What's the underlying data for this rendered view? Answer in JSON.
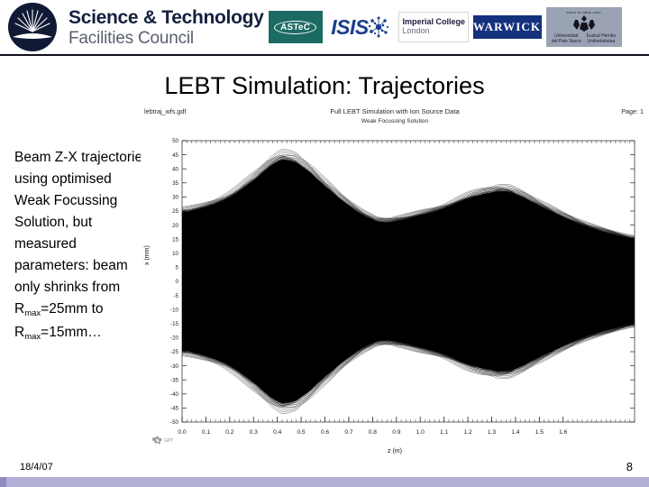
{
  "header": {
    "organisation": {
      "line1": "Science & Technology",
      "line2": "Facilities Council",
      "logo_icon": "stfc-sunburst-icon",
      "brand_color": "#111a35"
    },
    "partner_logos": [
      {
        "name": "astec-logo",
        "label": "ASTeC",
        "background": "#1c6b63",
        "text_color": "#ffffff"
      },
      {
        "name": "isis-logo",
        "label": "ISIS",
        "background": "#ffffff",
        "text_color": "#1b3f8f"
      },
      {
        "name": "imperial-college-logo",
        "line1": "Imperial College",
        "line2": "London",
        "background": "#ffffff",
        "text_color": "#1a1a3c"
      },
      {
        "name": "warwick-logo",
        "label": "WARWICK",
        "background": "#15317e",
        "text_color": "#ffffff"
      },
      {
        "name": "upv-ehu-logo",
        "top_text": "eman ta zabal zazu",
        "line1": "Universidad",
        "line1b": "del Pais Vasco",
        "line2": "Euskal Herriko",
        "line2b": "Unibertsitatea",
        "background": "#9aa3b4"
      }
    ]
  },
  "slide": {
    "title": "LEBT Simulation: Trajectories",
    "body_text_part1": "Beam Z-X trajectories using optimised Weak Focussing Solution, but measured parameters: beam only shrinks from R",
    "body_sub1": "max",
    "body_text_part2": "=25mm to R",
    "body_sub2": "max",
    "body_text_part3": "=15mm…"
  },
  "figure": {
    "file_name": "lebtraj_wfs.gdf",
    "main_title": "Full LEBT Simulation with Ion Source Data",
    "sub_title": "Weak Focussing Solution",
    "page_label": "Page: 1",
    "watermark": "GPT"
  },
  "chart_data": {
    "type": "line",
    "title": "Full LEBT Simulation with Ion Source Data",
    "subtitle": "Weak Focussing Solution",
    "xlabel": "z (m)",
    "ylabel": "x (mm)",
    "xlim": [
      0.0,
      1.9
    ],
    "ylim": [
      -50,
      50
    ],
    "grid": false,
    "legend": null,
    "x_ticks": [
      0.0,
      0.1,
      0.2,
      0.3,
      0.4,
      0.5,
      0.6,
      0.7,
      0.8,
      0.9,
      1.0,
      1.1,
      1.2,
      1.3,
      1.4,
      1.5,
      1.6
    ],
    "x_tick_labels": [
      "0.0",
      "0.1",
      "0.2",
      "0.3",
      "0.4",
      "0.5",
      "0.6",
      "0.7",
      "0.8",
      "0.9",
      "1.0",
      "1.1",
      "1.2",
      "1.3",
      "1.4",
      "1.5",
      "1.6"
    ],
    "y_ticks": [
      -50,
      -45,
      -40,
      -35,
      -30,
      -25,
      -20,
      -15,
      -10,
      -5,
      0,
      5,
      10,
      15,
      20,
      25,
      30,
      35,
      40,
      45,
      50
    ],
    "y_tick_labels": [
      "-50",
      "-45",
      "-40",
      "-35",
      "-30",
      "-25",
      "-20",
      "-15",
      "-10",
      "-5",
      "0",
      "5",
      "10",
      "15",
      "20",
      "25",
      "30",
      "35",
      "40",
      "45",
      "50"
    ],
    "series": [
      {
        "name": "envelope-upper",
        "x": [
          0.0,
          0.1,
          0.2,
          0.3,
          0.4,
          0.45,
          0.5,
          0.6,
          0.7,
          0.8,
          0.85,
          0.9,
          1.0,
          1.1,
          1.2,
          1.3,
          1.35,
          1.4,
          1.5,
          1.6,
          1.7,
          1.8,
          1.9
        ],
        "values": [
          24.5,
          26.5,
          30.0,
          36.0,
          42.5,
          43.0,
          41.0,
          34.0,
          27.0,
          22.0,
          21.0,
          21.5,
          23.5,
          26.0,
          29.5,
          31.5,
          32.0,
          31.0,
          27.0,
          23.0,
          19.5,
          17.0,
          15.0
        ]
      },
      {
        "name": "envelope-lower",
        "x": [
          0.0,
          0.1,
          0.2,
          0.3,
          0.4,
          0.45,
          0.5,
          0.6,
          0.7,
          0.8,
          0.85,
          0.9,
          1.0,
          1.1,
          1.2,
          1.3,
          1.35,
          1.4,
          1.5,
          1.6,
          1.7,
          1.8,
          1.9
        ],
        "values": [
          -24.5,
          -26.5,
          -30.0,
          -36.0,
          -42.5,
          -43.0,
          -41.0,
          -34.0,
          -27.0,
          -22.0,
          -21.0,
          -21.5,
          -23.5,
          -26.0,
          -29.5,
          -31.5,
          -32.0,
          -31.0,
          -27.0,
          -23.0,
          -19.5,
          -17.0,
          -15.0
        ]
      }
    ],
    "notes": "Dense bundle of many individual particle trajectories filling the envelope; plotted solid black."
  },
  "footer": {
    "date": "18/4/07",
    "page_number": "8",
    "bar_color": "#b3b0d8"
  }
}
